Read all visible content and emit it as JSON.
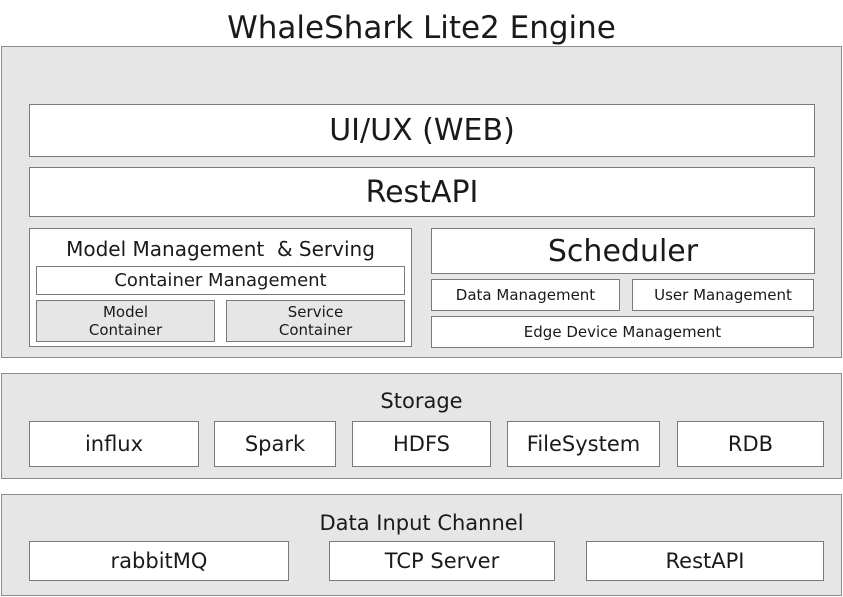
{
  "title": "WhaleShark Lite2 Engine",
  "engine": {
    "ui_label": "UI/UX (WEB)",
    "rest_label": "RestAPI",
    "model_mgmt": {
      "title": "Model Management  & Serving",
      "container_mgmt": "Container Management",
      "model_container": "Model\nContainer",
      "service_container": "Service\nContainer"
    },
    "scheduler": {
      "title": "Scheduler",
      "data_mgmt": "Data Management",
      "user_mgmt": "User Management",
      "edge_mgmt": "Edge Device Management"
    }
  },
  "storage": {
    "title": "Storage",
    "items": [
      "influx",
      "Spark",
      "HDFS",
      "FileSystem",
      "RDB"
    ]
  },
  "input": {
    "title": "Data Input Channel",
    "items": [
      "rabbitMQ",
      "TCP Server",
      "RestAPI"
    ]
  }
}
